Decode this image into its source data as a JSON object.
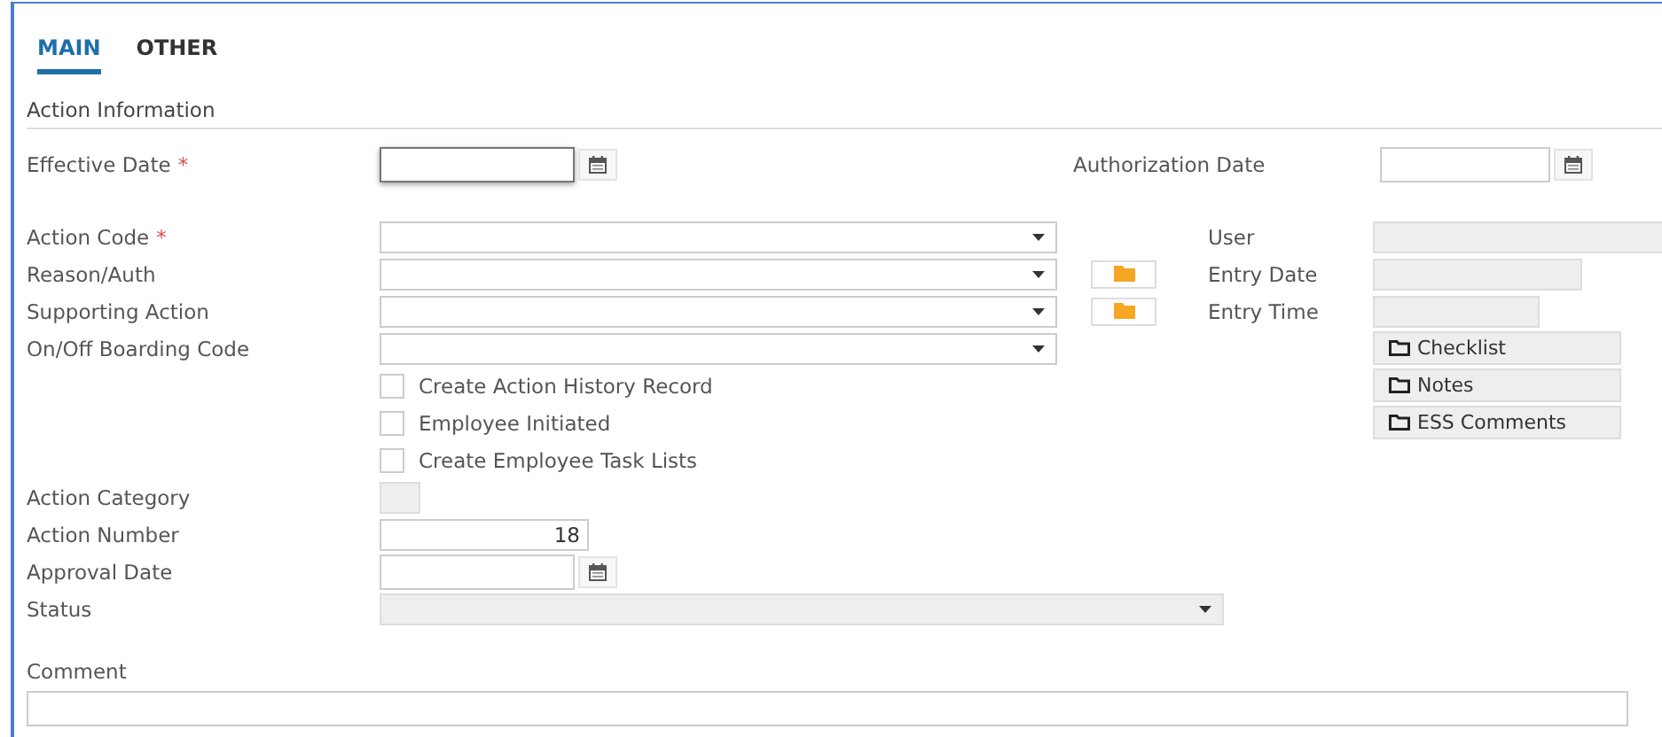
{
  "tabs": [
    {
      "label": "MAIN",
      "selected": true
    },
    {
      "label": "OTHER",
      "selected": false
    }
  ],
  "section_title": "Action Information",
  "effective_date": {
    "label": "Effective Date",
    "required_mark": "*"
  },
  "authorization_date": {
    "label": "Authorization Date"
  },
  "left_fields": [
    {
      "label": "Action Code",
      "required_mark": "*",
      "folder_button": false
    },
    {
      "label": "Reason/Auth",
      "folder_button": true
    },
    {
      "label": "Supporting Action",
      "folder_button": true
    },
    {
      "label": "On/Off Boarding Code",
      "folder_button": false
    }
  ],
  "right_fields": [
    {
      "label": "User"
    },
    {
      "label": "Entry Date"
    },
    {
      "label": "Entry Time"
    }
  ],
  "side_buttons": [
    "Checklist",
    "Notes",
    "ESS Comments"
  ],
  "checkboxes": [
    {
      "label": "Create Action History Record",
      "checked": false
    },
    {
      "label": "Employee Initiated",
      "checked": false
    },
    {
      "label": "Create Employee Task Lists",
      "checked": false
    }
  ],
  "lower_fields": [
    {
      "label": "Action Category",
      "kind": "code"
    },
    {
      "label": "Action Number",
      "kind": "number",
      "value": "18"
    },
    {
      "label": "Approval Date",
      "kind": "date"
    },
    {
      "label": "Status",
      "kind": "dropdown",
      "disabled": true
    }
  ],
  "comment": {
    "label": "Comment"
  }
}
